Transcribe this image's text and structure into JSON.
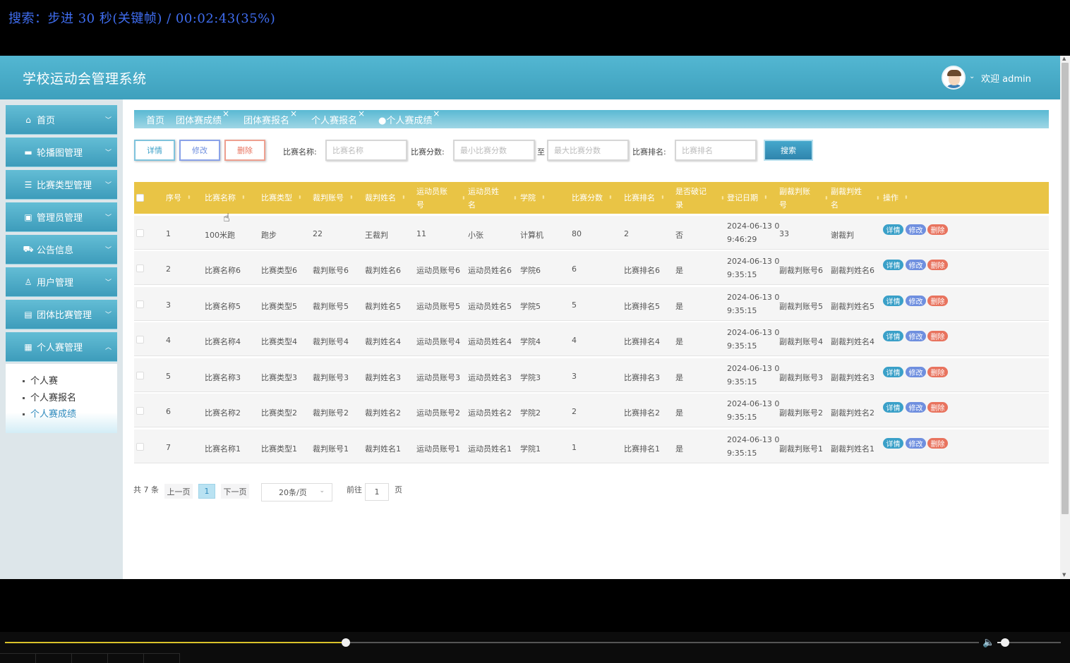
{
  "osd": {
    "text": "搜索：步进 30 秒(关键帧) / 00:02:43(35%)"
  },
  "header": {
    "title": "学校运动会管理系统",
    "welcome": "欢迎 admin"
  },
  "sidebar": {
    "items": [
      {
        "label": "首页",
        "icon": "home-icon"
      },
      {
        "label": "轮播图管理",
        "icon": "carousel-icon"
      },
      {
        "label": "比赛类型管理",
        "icon": "list-icon"
      },
      {
        "label": "管理员管理",
        "icon": "chip-icon"
      },
      {
        "label": "公告信息",
        "icon": "car-icon"
      },
      {
        "label": "用户管理",
        "icon": "user-icon"
      },
      {
        "label": "团体比赛管理",
        "icon": "team-icon"
      },
      {
        "label": "个人赛管理",
        "icon": "grid-icon"
      }
    ],
    "submenu": [
      "个人赛",
      "个人赛报名",
      "个人赛成绩"
    ]
  },
  "tabs": [
    "首页",
    "团体赛成绩",
    "团体赛报名",
    "个人赛报名",
    "●个人赛成绩"
  ],
  "toolbar": {
    "detail": "详情",
    "edit": "修改",
    "delete": "删除",
    "name_label": "比赛名称:",
    "name_placeholder": "比赛名称",
    "score_label": "比赛分数:",
    "score_min_placeholder": "最小比赛分数",
    "to": "至",
    "score_max_placeholder": "最大比赛分数",
    "rank_label": "比赛排名:",
    "rank_placeholder": "比赛排名",
    "search": "搜索"
  },
  "table": {
    "headers": [
      "序号",
      "比赛名称",
      "比赛类型",
      "裁判账号",
      "裁判姓名",
      "运动员账号",
      "运动员姓名",
      "学院",
      "比赛分数",
      "比赛排名",
      "是否破记录",
      "登记日期",
      "副裁判账号",
      "副裁判姓名",
      "操作"
    ],
    "header_lines": [
      [
        "序号"
      ],
      [
        "比赛名称"
      ],
      [
        "比赛类型"
      ],
      [
        "裁判账号"
      ],
      [
        "裁判姓名"
      ],
      [
        "运动员账",
        "号"
      ],
      [
        "运动员姓",
        "名"
      ],
      [
        "学院"
      ],
      [
        "比赛分数"
      ],
      [
        "比赛排名"
      ],
      [
        "是否破记",
        "录"
      ],
      [
        "登记日期"
      ],
      [
        "副裁判账",
        "号"
      ],
      [
        "副裁判姓",
        "名"
      ],
      [
        "操作"
      ]
    ],
    "rows": [
      {
        "no": "1",
        "name": "100米跑",
        "type": "跑步",
        "ref_acc": "22",
        "ref_name": "王裁判",
        "ath_acc": "11",
        "ath_name": "小张",
        "college": "计算机",
        "score": "80",
        "rank": "2",
        "record": "否",
        "date1": "2024-06-13 0",
        "date2": "9:46:29",
        "sub_acc": "33",
        "sub_name": "谢裁判"
      },
      {
        "no": "2",
        "name": "比赛名称6",
        "type": "比赛类型6",
        "ref_acc": "裁判账号6",
        "ref_name": "裁判姓名6",
        "ath_acc": "运动员账号6",
        "ath_name": "运动员姓名6",
        "college": "学院6",
        "score": "6",
        "rank": "比赛排名6",
        "record": "是",
        "date1": "2024-06-13 0",
        "date2": "9:35:15",
        "sub_acc": "副裁判账号6",
        "sub_name": "副裁判姓名6"
      },
      {
        "no": "3",
        "name": "比赛名称5",
        "type": "比赛类型5",
        "ref_acc": "裁判账号5",
        "ref_name": "裁判姓名5",
        "ath_acc": "运动员账号5",
        "ath_name": "运动员姓名5",
        "college": "学院5",
        "score": "5",
        "rank": "比赛排名5",
        "record": "是",
        "date1": "2024-06-13 0",
        "date2": "9:35:15",
        "sub_acc": "副裁判账号5",
        "sub_name": "副裁判姓名5"
      },
      {
        "no": "4",
        "name": "比赛名称4",
        "type": "比赛类型4",
        "ref_acc": "裁判账号4",
        "ref_name": "裁判姓名4",
        "ath_acc": "运动员账号4",
        "ath_name": "运动员姓名4",
        "college": "学院4",
        "score": "4",
        "rank": "比赛排名4",
        "record": "是",
        "date1": "2024-06-13 0",
        "date2": "9:35:15",
        "sub_acc": "副裁判账号4",
        "sub_name": "副裁判姓名4"
      },
      {
        "no": "5",
        "name": "比赛名称3",
        "type": "比赛类型3",
        "ref_acc": "裁判账号3",
        "ref_name": "裁判姓名3",
        "ath_acc": "运动员账号3",
        "ath_name": "运动员姓名3",
        "college": "学院3",
        "score": "3",
        "rank": "比赛排名3",
        "record": "是",
        "date1": "2024-06-13 0",
        "date2": "9:35:15",
        "sub_acc": "副裁判账号3",
        "sub_name": "副裁判姓名3"
      },
      {
        "no": "6",
        "name": "比赛名称2",
        "type": "比赛类型2",
        "ref_acc": "裁判账号2",
        "ref_name": "裁判姓名2",
        "ath_acc": "运动员账号2",
        "ath_name": "运动员姓名2",
        "college": "学院2",
        "score": "2",
        "rank": "比赛排名2",
        "record": "是",
        "date1": "2024-06-13 0",
        "date2": "9:35:15",
        "sub_acc": "副裁判账号2",
        "sub_name": "副裁判姓名2"
      },
      {
        "no": "7",
        "name": "比赛名称1",
        "type": "比赛类型1",
        "ref_acc": "裁判账号1",
        "ref_name": "裁判姓名1",
        "ath_acc": "运动员账号1",
        "ath_name": "运动员姓名1",
        "college": "学院1",
        "score": "1",
        "rank": "比赛排名1",
        "record": "是",
        "date1": "2024-06-13 0",
        "date2": "9:35:15",
        "sub_acc": "副裁判账号1",
        "sub_name": "副裁判姓名1"
      }
    ],
    "row_actions": {
      "detail": "详情",
      "edit": "修改",
      "delete": "删除"
    }
  },
  "pagination": {
    "total": "共 7 条",
    "prev": "上一页",
    "current": "1",
    "next": "下一页",
    "page_size": "20条/页",
    "goto": "前往",
    "goto_value": "1",
    "page_unit": "页"
  },
  "player": {
    "progress": 0.35,
    "volume": 0.12
  },
  "colors": {
    "header": "#4aadc9",
    "table_header": "#e9c445",
    "detail": "#3aa0c8",
    "edit": "#6f8fdf",
    "delete": "#e8735e",
    "progress": "#d9c22a"
  }
}
